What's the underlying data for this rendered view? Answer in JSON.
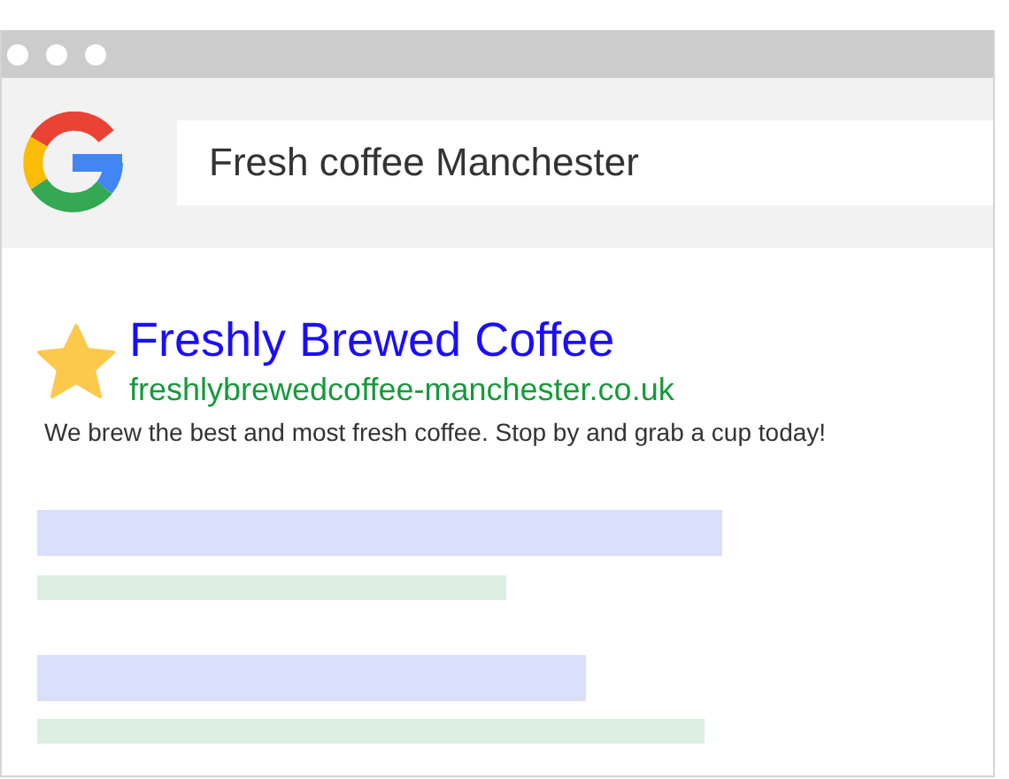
{
  "search": {
    "value": "Fresh coffee Manchester"
  },
  "result": {
    "title": "Freshly Brewed Coffee",
    "url": "freshlybrewedcoffee-manchester.co.uk",
    "description": "We brew the best and most fresh coffee. Stop by and grab a cup today!",
    "starred": true
  }
}
